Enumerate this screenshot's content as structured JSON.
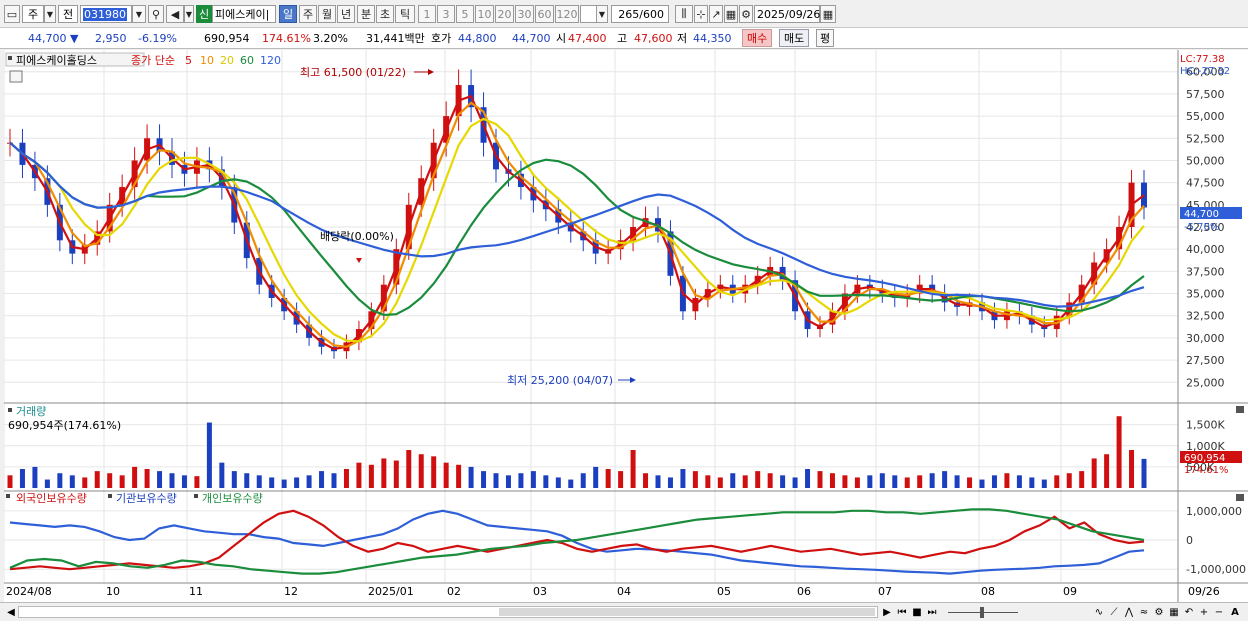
{
  "toolbar": {
    "market": "주",
    "scope": "전",
    "code": "031980",
    "new_badge": "신",
    "name": "피에스케이|",
    "periods": [
      "일",
      "주",
      "월",
      "년",
      "분",
      "초",
      "틱"
    ],
    "active_period": "일",
    "intervals": [
      "1",
      "3",
      "5",
      "10",
      "20",
      "30",
      "60",
      "120"
    ],
    "count": "265",
    "total": "/600",
    "date": "2025/09/26"
  },
  "quote": {
    "price": "44,700",
    "arrow": "▼",
    "change": "2,950",
    "change_pct": "-6.19%",
    "volume": "690,954",
    "vol_ratio": "174.61%",
    "turnover": "3.20%",
    "amount": "31,441백만",
    "label_hoga": "호가",
    "hoga_ask": "44,800",
    "hoga_bid": "44,700",
    "label_open": "시",
    "open": "47,400",
    "label_high": "고",
    "high": "47,600",
    "label_low": "저",
    "low": "44,350",
    "buy_label": "매수",
    "sell_label": "매도",
    "eval_label": "평"
  },
  "price_pane": {
    "stock_name": "피에스케이홀딩스",
    "ma_prefix": "종가 단순",
    "ma_periods": [
      {
        "label": "5",
        "color": "#d01010"
      },
      {
        "label": "10",
        "color": "#f08c00"
      },
      {
        "label": "20",
        "color": "#d8c800"
      },
      {
        "label": "60",
        "color": "#1a8c3c"
      },
      {
        "label": "120",
        "color": "#2e5fd8"
      }
    ],
    "lc": "LC:77.38",
    "hc": "HC:-27.32",
    "y_ticks": [
      "60,000",
      "57,500",
      "55,000",
      "52,500",
      "50,000",
      "47,500",
      "45,000",
      "42,500",
      "40,000",
      "37,500",
      "35,000",
      "32,500",
      "30,000",
      "27,500",
      "25,000"
    ],
    "y_tick_values": [
      60000,
      57500,
      55000,
      52500,
      50000,
      47500,
      45000,
      42500,
      40000,
      37500,
      35000,
      32500,
      30000,
      27500,
      25000
    ],
    "current_price_tag": "44,700",
    "current_change_tag": "-5.70%",
    "annot_high": "최고 61,500 (01/22)",
    "annot_low": "최저 25,200 (04/07)",
    "annot_dividend": "배당락(0.00%)"
  },
  "volume_pane": {
    "title": "거래량",
    "value_label": "690,954주(174.61%)",
    "y_ticks": [
      "1,500K",
      "1,000K",
      "500K"
    ],
    "current_tag": "690,954",
    "current_pct": "174.61%"
  },
  "holdings_pane": {
    "legend": [
      "외국인보유수량",
      "기관보유수량",
      "개인보유수량"
    ],
    "legend_colors": [
      "#2e5fd8",
      "#d01010",
      "#1a8c3c"
    ],
    "y_ticks": [
      "1,000,000",
      "0",
      "-1,000,000"
    ]
  },
  "x_axis": {
    "labels": [
      "2024/08",
      "10",
      "11",
      "12",
      "2025/01",
      "02",
      "03",
      "04",
      "05",
      "06",
      "07",
      "08",
      "09"
    ],
    "right_label": "09/26"
  },
  "chart_data": {
    "type": "line",
    "price_range": [
      23000,
      62000
    ],
    "close": [
      52000,
      49500,
      48000,
      45000,
      41000,
      39500,
      40500,
      42000,
      45000,
      47000,
      50000,
      52500,
      51000,
      49500,
      48500,
      50000,
      49000,
      47000,
      43000,
      39000,
      36000,
      34500,
      33000,
      31500,
      30000,
      29000,
      28500,
      29500,
      31000,
      33000,
      36000,
      40000,
      45000,
      48000,
      52000,
      55000,
      58500,
      56000,
      52000,
      49000,
      48500,
      47000,
      45500,
      44500,
      43000,
      42000,
      41000,
      39500,
      40000,
      41000,
      42500,
      43500,
      42000,
      37000,
      33000,
      34500,
      35500,
      36000,
      35000,
      36000,
      37000,
      38000,
      36500,
      33000,
      31000,
      31500,
      33000,
      35000,
      36000,
      35500,
      35000,
      34500,
      35000,
      36000,
      35000,
      34000,
      33500,
      34000,
      33000,
      32000,
      33000,
      32500,
      31500,
      31000,
      32500,
      34000,
      36000,
      38500,
      40000,
      42500,
      47500,
      44700
    ],
    "volume_k": [
      300,
      450,
      500,
      200,
      350,
      300,
      250,
      400,
      350,
      300,
      500,
      450,
      400,
      350,
      300,
      280,
      1550,
      600,
      400,
      350,
      300,
      250,
      200,
      250,
      300,
      400,
      350,
      450,
      600,
      550,
      700,
      650,
      900,
      800,
      750,
      600,
      550,
      500,
      400,
      350,
      300,
      350,
      400,
      300,
      250,
      200,
      350,
      500,
      450,
      400,
      900,
      350,
      300,
      250,
      450,
      400,
      300,
      250,
      350,
      300,
      400,
      350,
      300,
      250,
      450,
      400,
      350,
      300,
      250,
      300,
      350,
      300,
      250,
      300,
      350,
      400,
      300,
      250,
      200,
      300,
      350,
      300,
      250,
      200,
      300,
      350,
      400,
      700,
      800,
      1700,
      900,
      690
    ],
    "series_names": [
      "외국인보유수량",
      "기관보유수량",
      "개인보유수량"
    ],
    "foreign": [
      600000,
      550000,
      500000,
      450000,
      500000,
      450000,
      300000,
      100000,
      0,
      50000,
      400000,
      500000,
      400000,
      300000,
      250000,
      200000,
      200000,
      100000,
      50000,
      -100000,
      -150000,
      -200000,
      -100000,
      0,
      100000,
      200000,
      400000,
      700000,
      900000,
      1000000,
      900000,
      700000,
      500000,
      450000,
      400000,
      350000,
      300000,
      150000,
      -100000,
      -300000,
      -400000,
      -350000,
      -300000,
      -320000,
      -350000,
      -400000,
      -450000,
      -500000,
      -600000,
      -700000,
      -750000,
      -800000,
      -850000,
      -900000,
      -920000,
      -950000,
      -980000,
      -1000000,
      -1020000,
      -1050000,
      -1080000,
      -1100000,
      -1120000,
      -1150000,
      -1100000,
      -1050000,
      -1020000,
      -1000000,
      -980000,
      -950000,
      -900000,
      -880000,
      -850000,
      -800000,
      -600000,
      -400000,
      -350000
    ],
    "institution": [
      -1000000,
      -950000,
      -900000,
      -950000,
      -1000000,
      -950000,
      -900000,
      -850000,
      -800000,
      -850000,
      -900000,
      -950000,
      -900000,
      -800000,
      -600000,
      -200000,
      200000,
      600000,
      900000,
      1000000,
      800000,
      500000,
      100000,
      -200000,
      -400000,
      -300000,
      -100000,
      -200000,
      -400000,
      -300000,
      -200000,
      -300000,
      -400000,
      -300000,
      -200000,
      -100000,
      0,
      -100000,
      -300000,
      -400000,
      -300000,
      -200000,
      -150000,
      -300000,
      -400000,
      -300000,
      -250000,
      -200000,
      -300000,
      -400000,
      -300000,
      -200000,
      -300000,
      -400000,
      -350000,
      -300000,
      -400000,
      -500000,
      -450000,
      -400000,
      -500000,
      -600000,
      -500000,
      -400000,
      -450000,
      -300000,
      -200000,
      0,
      300000,
      500000,
      800000,
      400000,
      600000,
      200000,
      0,
      -100000,
      -50000
    ],
    "individual": [
      -950000,
      -700000,
      -650000,
      -700000,
      -900000,
      -750000,
      -800000,
      -900000,
      -950000,
      -850000,
      -700000,
      -750000,
      -850000,
      -900000,
      -1000000,
      -1050000,
      -1100000,
      -1150000,
      -1150000,
      -1100000,
      -1000000,
      -900000,
      -800000,
      -700000,
      -600000,
      -550000,
      -500000,
      -400000,
      -300000,
      -250000,
      -200000,
      -100000,
      -50000,
      0,
      100000,
      200000,
      300000,
      400000,
      500000,
      600000,
      700000,
      750000,
      800000,
      850000,
      900000,
      950000,
      950000,
      950000,
      950000,
      1000000,
      1000000,
      950000,
      950000,
      900000,
      950000,
      1000000,
      1050000,
      1050000,
      1000000,
      900000,
      800000,
      700000,
      500000,
      300000,
      200000,
      100000,
      0
    ]
  }
}
